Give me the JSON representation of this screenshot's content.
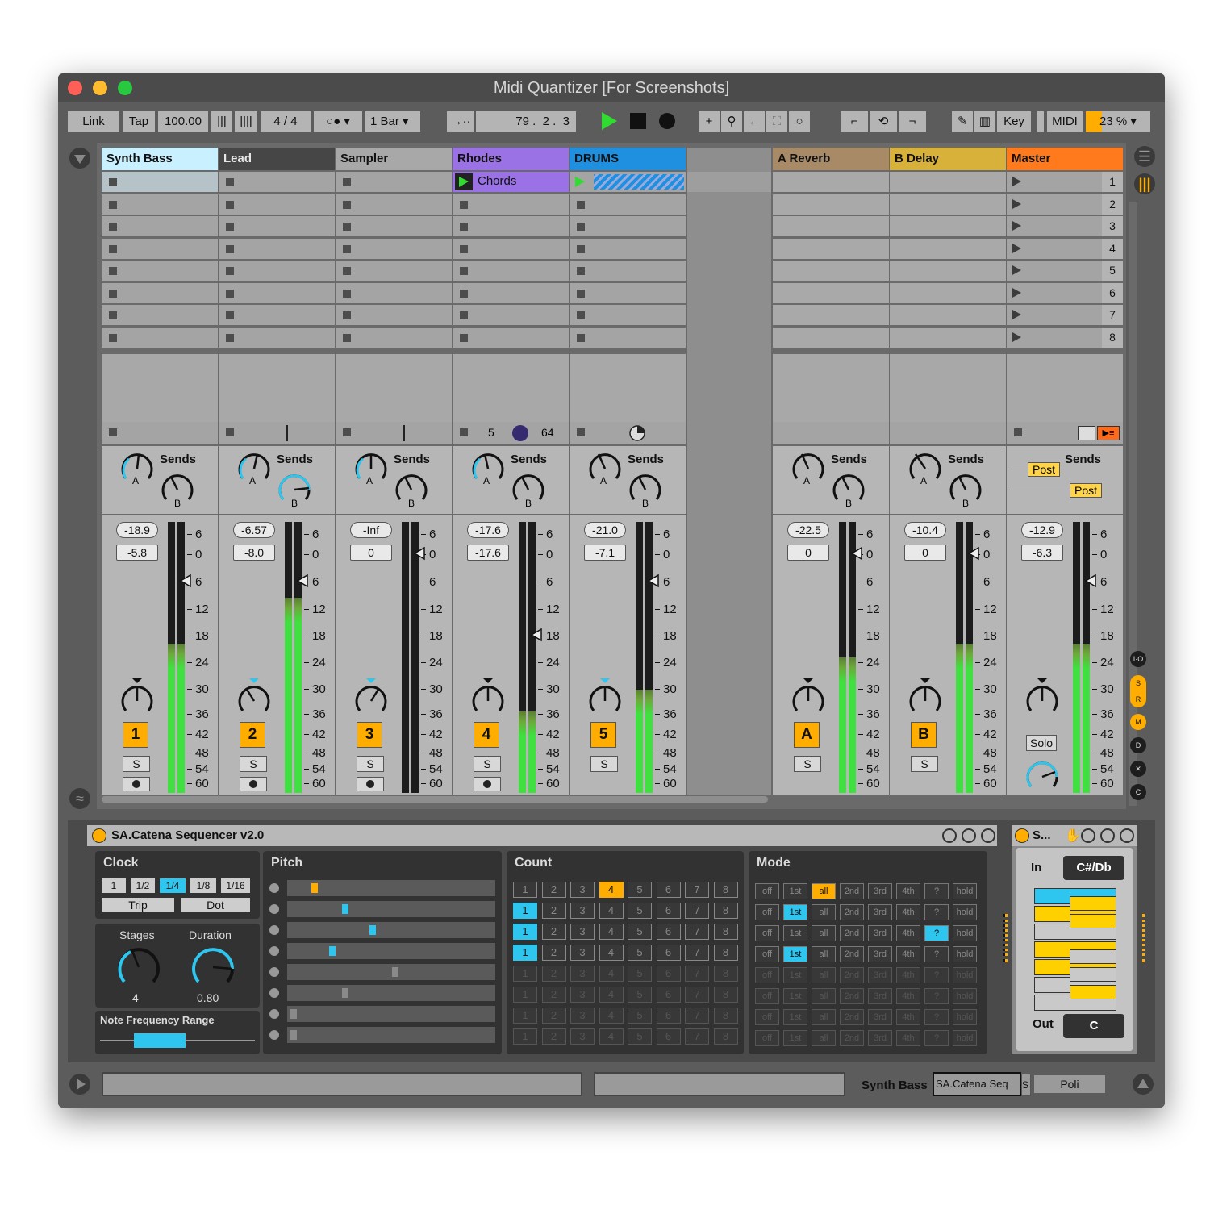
{
  "window": {
    "title": "Midi Quantizer  [For Screenshots]"
  },
  "toolbar": {
    "link": "Link",
    "tap": "Tap",
    "tempo": "100.00",
    "sig": "4  /  4",
    "quant": "1 Bar",
    "pos1": "79 .",
    "pos2": "2 .",
    "pos3": "3",
    "key": "Key",
    "midi": "MIDI",
    "cpu": "23 %"
  },
  "tracks": [
    {
      "name": "Synth Bass",
      "color": "#c8f0ff",
      "vol": "-18.9",
      "pan": "-5.8",
      "num": "1",
      "meter": 0.55,
      "arm": true
    },
    {
      "name": "Lead",
      "color": "#464646",
      "vol": "-6.57",
      "pan": "-8.0",
      "num": "2",
      "meter": 0.72,
      "arm": true
    },
    {
      "name": "Sampler",
      "color": "#a8a8a8",
      "vol": "-Inf",
      "pan": "0",
      "num": "3",
      "meter": 0,
      "arm": true
    },
    {
      "name": "Rhodes",
      "color": "#9a72e5",
      "vol": "-17.6",
      "pan": "-17.6",
      "num": "4",
      "meter": 0.3,
      "arm": false
    },
    {
      "name": "DRUMS",
      "color": "#1f8fe0",
      "vol": "-21.0",
      "pan": "-7.1",
      "num": "5",
      "meter": 0.38,
      "arm": false
    },
    {
      "name": "A Reverb",
      "color": "#a88a66",
      "vol": "-22.5",
      "pan": "0",
      "num": "A",
      "meter": 0.5
    },
    {
      "name": "B Delay",
      "color": "#d8b13a",
      "vol": "-10.4",
      "pan": "0",
      "num": "B",
      "meter": 0.55
    },
    {
      "name": "Master",
      "color": "#ff7a1c",
      "vol": "-12.9",
      "pan": "-6.3",
      "num": "",
      "meter": 0.55
    }
  ],
  "clips": {
    "chords": "Chords"
  },
  "rhodes_stop": {
    "a": "5",
    "b": "64"
  },
  "sends": "Sends",
  "post": "Post",
  "solo": "Solo",
  "knob_a": "A",
  "knob_b": "B",
  "scale_labels": [
    "6",
    "0",
    "6",
    "12",
    "18",
    "24",
    "30",
    "36",
    "42",
    "48",
    "54",
    "60"
  ],
  "scene_numbers": [
    "1",
    "2",
    "3",
    "4",
    "5",
    "6",
    "7",
    "8"
  ],
  "device": {
    "title": "SA.Catena Sequencer v2.0",
    "clock": "Clock",
    "clock_opts": [
      "1",
      "1/2",
      "1/4",
      "1/8",
      "1/16"
    ],
    "trip": "Trip",
    "dot": "Dot",
    "stages": "Stages",
    "duration": "Duration",
    "stages_val": "4",
    "duration_val": "0.80",
    "nfr": "Note Frequency Range",
    "pitch": "Pitch",
    "count": "Count",
    "mode": "Mode",
    "mode_opts": [
      "off",
      "1st",
      "all",
      "2nd",
      "3rd",
      "4th",
      "?",
      "hold"
    ]
  },
  "quant_dev": {
    "title": "S...",
    "in": "In",
    "in_val": "C#/Db",
    "out": "Out",
    "out_val": "C"
  },
  "status": {
    "track": "Synth Bass",
    "device": "SA.Catena Seq",
    "device2": "S",
    "poli": "Poli"
  }
}
